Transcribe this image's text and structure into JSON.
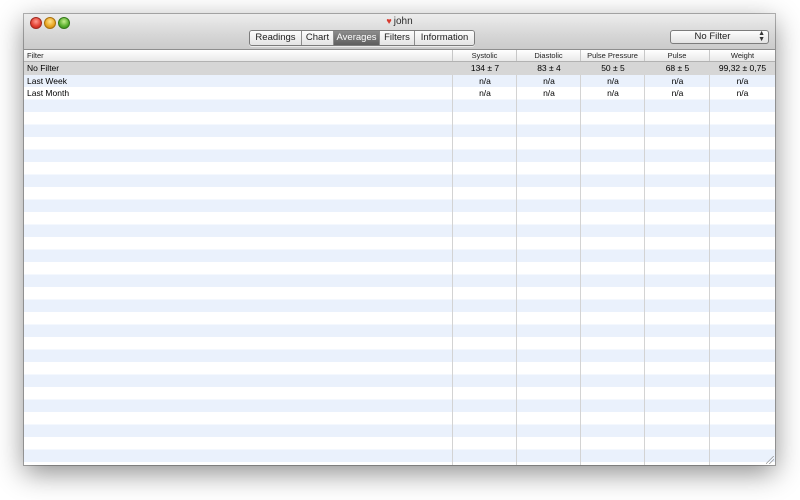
{
  "window": {
    "title": "john",
    "icon": "heart-icon"
  },
  "toolbar": {
    "tabs": [
      {
        "label": "Readings"
      },
      {
        "label": "Chart"
      },
      {
        "label": "Averages",
        "active": true
      },
      {
        "label": "Filters"
      },
      {
        "label": "Information"
      }
    ],
    "filter_popup": {
      "value": "No Filter"
    }
  },
  "table": {
    "columns": [
      "Filter",
      "Systolic",
      "Diastolic",
      "Pulse Pressure",
      "Pulse",
      "Weight"
    ],
    "rows": [
      {
        "cells": [
          "No Filter",
          "134 ± 7",
          "83 ± 4",
          "50 ± 5",
          "68 ± 5",
          "99,32 ± 0,75"
        ],
        "selected": true
      },
      {
        "cells": [
          "Last Week",
          "n/a",
          "n/a",
          "n/a",
          "n/a",
          "n/a"
        ],
        "selected": false
      },
      {
        "cells": [
          "Last Month",
          "n/a",
          "n/a",
          "n/a",
          "n/a",
          "n/a"
        ],
        "selected": false
      }
    ]
  },
  "colors": {
    "stripe": "#eaf1fc",
    "selected_row": "#d6d6d6",
    "active_segment": "#6e6e6e"
  }
}
